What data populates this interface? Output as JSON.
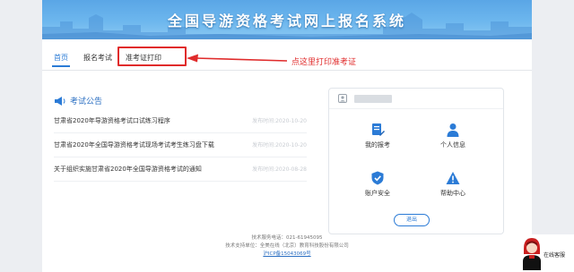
{
  "banner": {
    "title": "全国导游资格考试网上报名系统"
  },
  "nav": {
    "tabs": [
      {
        "label": "首页",
        "active": true
      },
      {
        "label": "报名考试",
        "active": false
      },
      {
        "label": "准考证打印",
        "active": false
      }
    ]
  },
  "annotation": {
    "text": "点这里打印准考证",
    "color": "#e02b2b"
  },
  "notices": {
    "heading": "考试公告",
    "items": [
      {
        "title": "甘肃省2020年导游资格考试口试练习程序",
        "time": "发布时间:2020-10-20"
      },
      {
        "title": "甘肃省2020年全国导游资格考试现场考试考生练习盘下载",
        "time": "发布时间:2020-10-20"
      },
      {
        "title": "关于组织实施甘肃省2020年全国导游资格考试的通知",
        "time": "发布时间:2020-08-28"
      }
    ]
  },
  "user_card": {
    "functions": [
      {
        "label": "我的报考",
        "icon": "document-edit-icon"
      },
      {
        "label": "个人信息",
        "icon": "person-icon"
      },
      {
        "label": "账户安全",
        "icon": "shield-check-icon"
      },
      {
        "label": "帮助中心",
        "icon": "warning-triangle-icon"
      }
    ],
    "logout_label": "退出"
  },
  "footer": {
    "service_phone": "技术服务电话：021-61945095",
    "support_unit": "技术支持单位：全美在线（北京）教育科技股份有限公司",
    "icp": "沪ICP备15043069号"
  },
  "customer_service": {
    "label": "在线客服"
  },
  "colors": {
    "accent": "#2b7bd6",
    "annotation": "#e02b2b",
    "banner": "#5aa6e6"
  }
}
